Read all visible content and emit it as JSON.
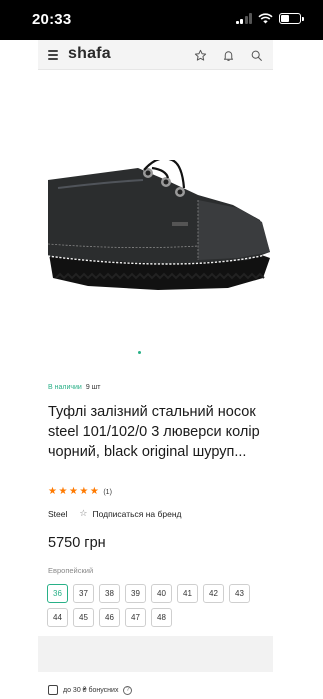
{
  "status_bar": {
    "time": "20:33"
  },
  "header": {
    "logo": "shafa"
  },
  "product": {
    "availability_label": "В наличии",
    "quantity": "9 шт",
    "title": "Туфлі залізний стальний носок steel 101/102/0 3 люверси колір чорний, black original шуруп...",
    "rating_value": 5,
    "rating_count": "(1)",
    "brand": "Steel",
    "subscribe_label": "Подписаться на бренд",
    "price": "5750 грн",
    "size_system": "Европейский",
    "sizes": [
      "36",
      "37",
      "38",
      "39",
      "40",
      "41",
      "42",
      "43",
      "44",
      "45",
      "46",
      "47",
      "48"
    ],
    "selected_size": "36",
    "bonus_text": "до 30 ₴ бонусних"
  },
  "colors": {
    "accent": "#28b087",
    "star": "#ff7a00"
  }
}
